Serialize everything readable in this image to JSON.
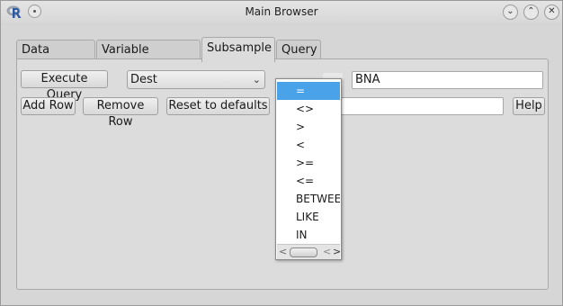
{
  "window": {
    "title": "Main Browser",
    "buttons": {
      "minimize": "⌄",
      "maximize": "⌃",
      "close": "✕"
    }
  },
  "tabs": [
    {
      "label": "Data Viewer",
      "active": false
    },
    {
      "label": "Variable Browser",
      "active": false
    },
    {
      "label": "Subsample",
      "active": true
    },
    {
      "label": "Query",
      "active": false
    }
  ],
  "toolbar": {
    "execute_label": "Execute Query",
    "add_row_label": "Add Row",
    "remove_row_label": "Remove Row",
    "reset_label": "Reset to defaults",
    "help_label": "Help"
  },
  "query_row": {
    "variable": "Dest",
    "operator": "=",
    "value": "BNA",
    "second_value": ""
  },
  "operator_dropdown": {
    "options": [
      "=",
      "<>",
      ">",
      "<",
      ">=",
      "<=",
      "BETWEEN",
      "LIKE",
      "IN"
    ],
    "selected_index": 0
  },
  "colors": {
    "selection": "#4aa3e8",
    "window_bg": "#d6d6d6"
  }
}
